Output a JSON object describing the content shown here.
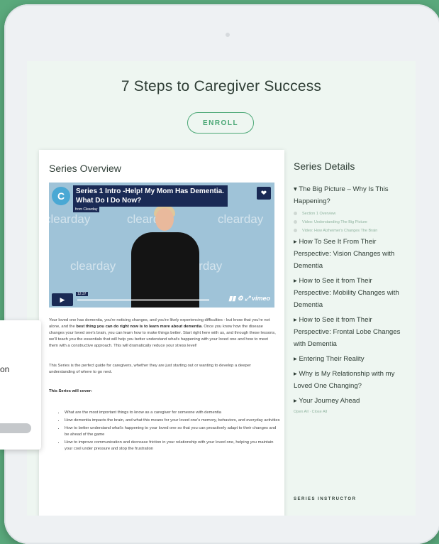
{
  "page": {
    "title": "7 Steps to Caregiver Success",
    "enroll_label": "ENROLL"
  },
  "overview": {
    "heading": "Series Overview",
    "video": {
      "title": "Series 1 Intro -Help! My Mom Has Dementia. What Do I Do Now?",
      "from": "from Clearday",
      "watermark": "clearday",
      "time": "12:37",
      "brand": "vimeo",
      "logo_letter": "C"
    },
    "paragraph1_start": "Your loved one has dementia, you're noticing changes, and you're likely experiencing difficulties - but know that you're not alone, and the ",
    "paragraph1_bold": "best thing you can do right now is to learn more about dementia",
    "paragraph1_end": ". Once you know how the disease changes your loved one's brain, you can learn how to make things better. Start right here with us, and through these lessons, we'll teach you the essentials that will help you better understand what's happening with your loved one and how to meet them with a constructive approach. This will dramatically reduce your stress level!",
    "paragraph2": "This Series is the perfect guide for caregivers, whether they are just starting out or wanting to develop a deeper understanding of where to go next.",
    "cover_heading": "This Series will cover:",
    "cover_items": [
      "What are the most important things to know as a caregiver for someone with dementia",
      "How dementia impacts the brain, and what this means for your loved one's memory, behaviors, and everyday activities",
      "How to better understand what's happening to your loved one so that you can proactively adapt to their changes and be ahead of the game",
      "How to improve communication and decrease friction in your relationship with your loved one, helping you maintain your cool under pressure and stop the frustration"
    ]
  },
  "details": {
    "heading": "Series Details",
    "modules": [
      {
        "label": "▾ The Big Picture – Why Is This Happening?",
        "subs": [
          "Section 1 Overview",
          "Video: Understanding The Big Picture",
          "Video: How Alzheimer's Changes The Brain"
        ]
      },
      {
        "label": "▸ How To See It From Their Perspective: Vision Changes with Dementia"
      },
      {
        "label": "▸ How to See it from Their Perspective: Mobility Changes with Dementia"
      },
      {
        "label": "▸ How to See it from Their Perspective: Frontal Lobe Changes with Dementia"
      },
      {
        "label": "▸ Entering Their Reality"
      },
      {
        "label": "▸ Why is My Relationship with my Loved One Changing?"
      },
      {
        "label": "▸ Your Journey Ahead"
      }
    ],
    "open_close": "Open All · Close All",
    "instructor_heading": "SERIES INSTRUCTOR"
  },
  "popup": {
    "partial_text": "on"
  },
  "colors": {
    "background": "#5aa97c",
    "accent": "#4aa775",
    "screen": "#eef6f1"
  }
}
